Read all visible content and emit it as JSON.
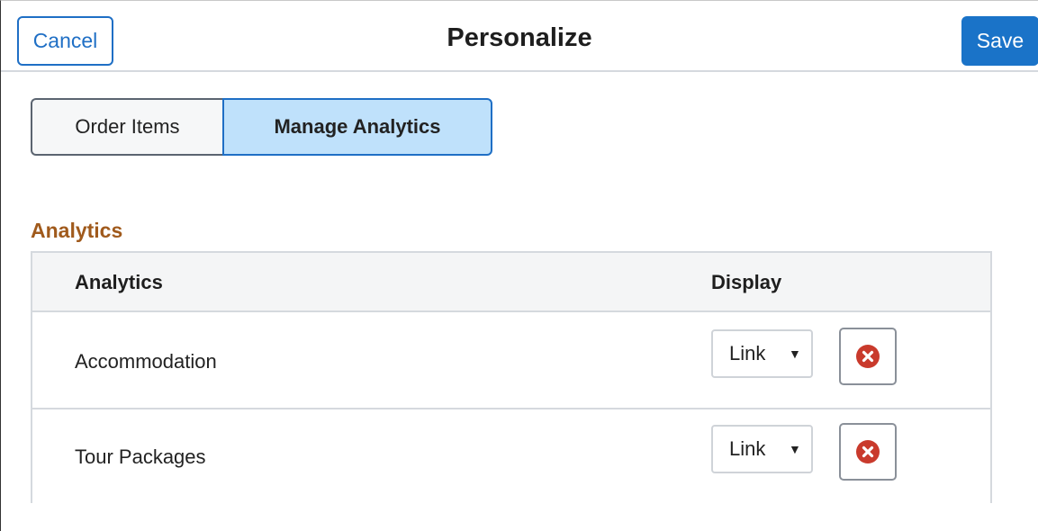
{
  "header": {
    "title": "Personalize",
    "cancel_label": "Cancel",
    "save_label": "Save"
  },
  "tabs": [
    {
      "label": "Order Items",
      "selected": false
    },
    {
      "label": "Manage Analytics",
      "selected": true
    }
  ],
  "section": {
    "title": "Analytics"
  },
  "grid": {
    "columns": [
      "Analytics",
      "Display"
    ],
    "rows": [
      {
        "name": "Accommodation",
        "display": "Link",
        "delete_icon": "close-circle-icon"
      },
      {
        "name": "Tour Packages",
        "display": "Link",
        "delete_icon": "close-circle-icon"
      }
    ]
  },
  "colors": {
    "accent": "#1a73c8",
    "section_title": "#a05a1c",
    "selected_tab_bg": "#bfe1fb",
    "delete_icon": "#c93a2c"
  }
}
